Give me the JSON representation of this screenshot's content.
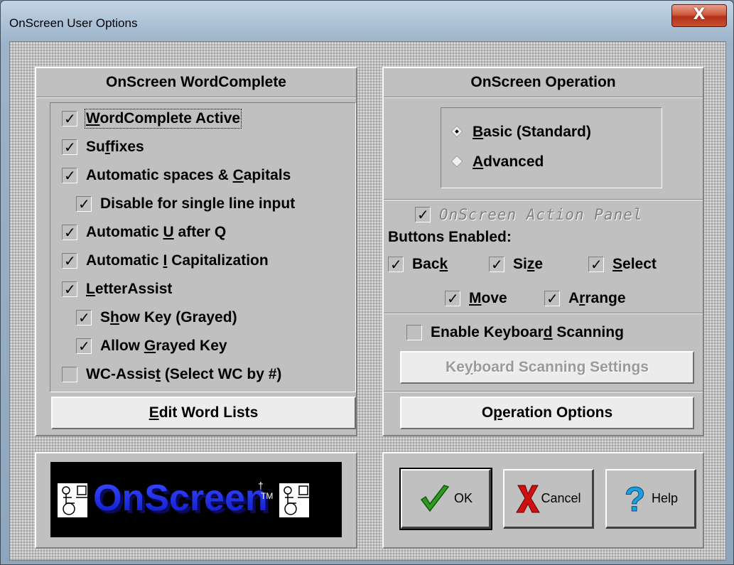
{
  "window": {
    "title": "OnScreen User Options",
    "close_glyph": "X"
  },
  "wordcomplete": {
    "header": "OnScreen WordComplete",
    "items": [
      {
        "label": "WordComplete Active",
        "checked": true
      },
      {
        "label": "Suffixes",
        "checked": true
      },
      {
        "label": "Automatic spaces & Capitals",
        "checked": true
      },
      {
        "label": "Disable for single line input",
        "checked": true
      },
      {
        "label": "Automatic U after Q",
        "checked": true
      },
      {
        "label": "Automatic I Capitalization",
        "checked": true
      },
      {
        "label": "LetterAssist",
        "checked": true
      },
      {
        "label": "Show Key (Grayed)",
        "checked": true
      },
      {
        "label": "Allow Grayed Key",
        "checked": true
      },
      {
        "label": "WC-Assist (Select WC by #)",
        "checked": false
      }
    ],
    "edit_button": "Edit Word Lists"
  },
  "operation": {
    "header": "OnScreen Operation",
    "modes": [
      {
        "label": "Basic (Standard)",
        "selected": true
      },
      {
        "label": "Advanced",
        "selected": false
      }
    ],
    "action_panel": {
      "label": "OnScreen Action Panel",
      "checked": true
    },
    "buttons_enabled_label": "Buttons Enabled:",
    "buttons": [
      {
        "label": "Back",
        "checked": true
      },
      {
        "label": "Size",
        "checked": true
      },
      {
        "label": "Select",
        "checked": true
      },
      {
        "label": "Move",
        "checked": true
      },
      {
        "label": "Arrange",
        "checked": true
      }
    ],
    "keyboard_scanning": {
      "label": "Enable Keyboard Scanning",
      "checked": false
    },
    "scanning_settings_button": "Keyboard Scanning Settings",
    "options_button": "Operation Options"
  },
  "logo": {
    "text": "OnScreen",
    "mark": "†",
    "tm": "TM"
  },
  "footer": {
    "ok": "OK",
    "cancel": "Cancel",
    "help": "Help"
  },
  "colors": {
    "logo_blue": "#1a2cff",
    "check_green": "#2e9a1e",
    "cancel_red": "#d01010",
    "help_blue": "#1aa0e0"
  }
}
